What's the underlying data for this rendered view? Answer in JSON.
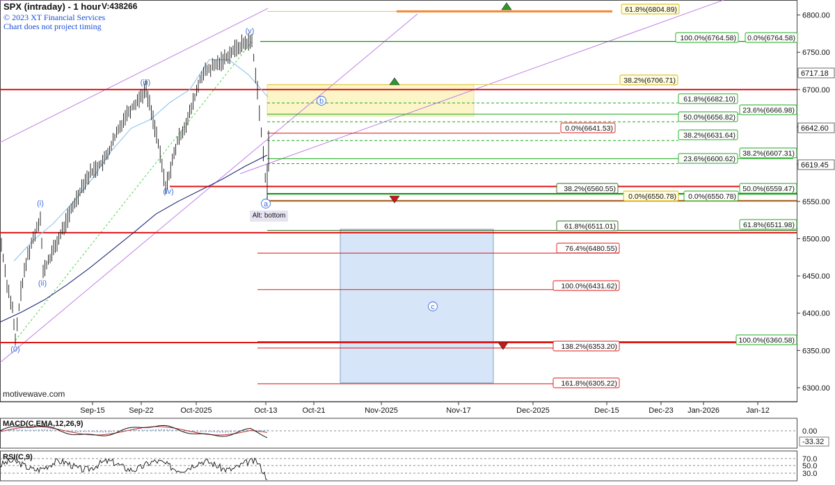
{
  "header": {
    "title": "SPX (intraday) - 1 hour",
    "volume": "V:438266",
    "copyright": "© 2023 XT Financial Services",
    "disclaimer": "Chart does not project timing",
    "watermark": "motivewave.com",
    "alt_note": "Alt: bottom"
  },
  "colors": {
    "red": "#e01414",
    "green": "#18a818",
    "dark_green": "#2e6e18",
    "orange": "#f08a30",
    "blue_wave": "#3f6fd8",
    "ma_light": "#8ec3ea",
    "ma_dark": "#1e2a78",
    "channel": "#c07de6",
    "zone_yellow": "#fbf5c8",
    "zone_blue": "#d6e6f8"
  },
  "chart_data": {
    "type": "line",
    "title": "SPX (intraday) - 1 hour",
    "xlabel": "",
    "ylabel": "",
    "x_ticks": [
      "Sep-15",
      "Sep-22",
      "Oct-2025",
      "Oct-13",
      "Oct-21",
      "Nov-2025",
      "Nov-17",
      "Dec-2025",
      "Dec-15",
      "Dec-23",
      "Jan-2026",
      "Jan-12"
    ],
    "y_ticks": [
      "6300.00",
      "6350.00",
      "6400.00",
      "6450.00",
      "6500.00",
      "6550.00",
      "6600.00",
      "6650.00",
      "6700.00",
      "6750.00",
      "6800.00"
    ],
    "ylim": [
      6286,
      6819
    ],
    "grid": false,
    "price_path": [
      {
        "x": "Sep-2",
        "y": 6492
      },
      {
        "x": "Sep-4",
        "y": 6440
      },
      {
        "x": "Sep-5",
        "y": 6405
      },
      {
        "x": "Sep-5b",
        "y": 6362
      },
      {
        "x": "Sep-8",
        "y": 6430
      },
      {
        "x": "Sep-9",
        "y": 6478
      },
      {
        "x": "Sep-10",
        "y": 6530
      },
      {
        "x": "Sep-11",
        "y": 6455
      },
      {
        "x": "Sep-12",
        "y": 6495
      },
      {
        "x": "Sep-15",
        "y": 6575
      },
      {
        "x": "Sep-16",
        "y": 6588
      },
      {
        "x": "Sep-18",
        "y": 6605
      },
      {
        "x": "Sep-19",
        "y": 6665
      },
      {
        "x": "Sep-22",
        "y": 6700
      },
      {
        "x": "Sep-24",
        "y": 6640
      },
      {
        "x": "Sep-25",
        "y": 6568
      },
      {
        "x": "Sep-26",
        "y": 6630
      },
      {
        "x": "Sep-29",
        "y": 6660
      },
      {
        "x": "Oct-1",
        "y": 6720
      },
      {
        "x": "Oct-3",
        "y": 6738
      },
      {
        "x": "Oct-6",
        "y": 6752
      },
      {
        "x": "Oct-8",
        "y": 6762
      },
      {
        "x": "Oct-9",
        "y": 6764.6
      },
      {
        "x": "Oct-10",
        "y": 6700
      },
      {
        "x": "Oct-10b",
        "y": 6552
      },
      {
        "x": "Oct-13",
        "y": 6640
      }
    ],
    "ma_fast": [
      6470,
      6498,
      6520,
      6548,
      6580,
      6618,
      6648,
      6660,
      6683,
      6700,
      6740,
      6740,
      6720,
      6690
    ],
    "ma_slow": [
      6388,
      6402,
      6418,
      6438,
      6460,
      6484,
      6508,
      6533,
      6550,
      6565,
      6580,
      6597,
      6612
    ],
    "waves": [
      {
        "label": "(0)",
        "price": 6360.58
      },
      {
        "label": "(i)",
        "price": 6530
      },
      {
        "label": "(ii)",
        "price": 6455
      },
      {
        "label": "(iii)",
        "price": 6700
      },
      {
        "label": "(iv)",
        "price": 6568
      },
      {
        "label": "(v)",
        "price": 6764.58
      },
      {
        "label": "a",
        "price": 6550.78
      },
      {
        "label": "b",
        "price": 6682
      },
      {
        "label": "c",
        "price": 6430
      }
    ],
    "current_prices": [
      "6717.18",
      "6642.60",
      "6619.45"
    ],
    "fib_levels": [
      {
        "label": "61.8%(6804.89)",
        "price": 6804.89,
        "color": "yellow"
      },
      {
        "label": "100.0%(6764.58)",
        "price": 6764.58,
        "color": "green"
      },
      {
        "label": "0.0%(6764.58)",
        "price": 6764.58,
        "color": "green"
      },
      {
        "label": "38.2%(6706.71)",
        "price": 6706.71,
        "color": "yellow"
      },
      {
        "label": "61.8%(6682.10)",
        "price": 6682.1,
        "color": "green"
      },
      {
        "label": "23.6%(6666.98)",
        "price": 6666.98,
        "color": "green"
      },
      {
        "label": "50.0%(6656.82)",
        "price": 6656.82,
        "color": "green"
      },
      {
        "label": "0.0%(6641.53)",
        "price": 6641.53,
        "color": "red"
      },
      {
        "label": "38.2%(6631.64)",
        "price": 6631.64,
        "color": "green"
      },
      {
        "label": "38.2%(6607.31)",
        "price": 6607.31,
        "color": "green"
      },
      {
        "label": "23.6%(6600.62)",
        "price": 6600.62,
        "color": "green"
      },
      {
        "label": "38.2%(6560.55)",
        "price": 6560.55,
        "color": "black"
      },
      {
        "label": "50.0%(6559.47)",
        "price": 6559.47,
        "color": "green"
      },
      {
        "label": "0.0%(6550.78)",
        "price": 6550.78,
        "color": "yellow"
      },
      {
        "label": "0.0%(6550.78)",
        "price": 6550.78,
        "color": "green"
      },
      {
        "label": "61.8%(6511.01)",
        "price": 6511.01,
        "color": "black"
      },
      {
        "label": "61.8%(6511.98)",
        "price": 6511.98,
        "color": "green"
      },
      {
        "label": "76.4%(6480.55)",
        "price": 6480.55,
        "color": "red"
      },
      {
        "label": "100.0%(6431.62)",
        "price": 6431.62,
        "color": "red"
      },
      {
        "label": "100.0%(6360.58)",
        "price": 6360.58,
        "color": "green"
      },
      {
        "label": "138.2%(6353.20)",
        "price": 6353.2,
        "color": "red"
      },
      {
        "label": "161.8%(6305.22)",
        "price": 6305.22,
        "color": "red"
      }
    ],
    "macd": {
      "label": "MACD(C,EMA,12,26,9)",
      "ticks": [
        "0.00",
        "-33.32"
      ]
    },
    "rsi": {
      "label": "RSI(C,9)",
      "ticks": [
        "70.0",
        "50.0",
        "30.0"
      ]
    }
  }
}
